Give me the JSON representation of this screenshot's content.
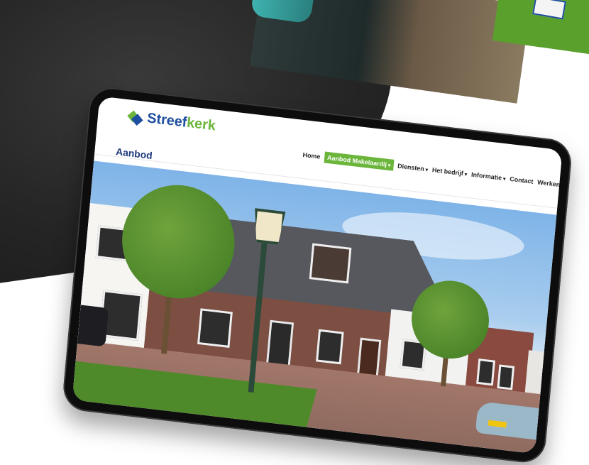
{
  "site": {
    "logo_part1": "Streef",
    "logo_part2": "kerk"
  },
  "nav": [
    {
      "label": "Home",
      "has_caret": false,
      "active": false
    },
    {
      "label": "Aanbod Makelaardij",
      "has_caret": true,
      "active": true
    },
    {
      "label": "Diensten",
      "has_caret": true,
      "active": false
    },
    {
      "label": "Het bedrijf",
      "has_caret": true,
      "active": false
    },
    {
      "label": "Informatie",
      "has_caret": true,
      "active": false
    },
    {
      "label": "Contact",
      "has_caret": false,
      "active": false
    },
    {
      "label": "Werken bij Streefkerk",
      "has_caret": false,
      "active": false
    }
  ],
  "page": {
    "heading": "Aanbod"
  },
  "colors": {
    "brand_blue": "#1e4ea0",
    "brand_green": "#6bb53b",
    "active_nav_bg": "#6bb53b"
  },
  "icons": {
    "caret": "▾"
  }
}
